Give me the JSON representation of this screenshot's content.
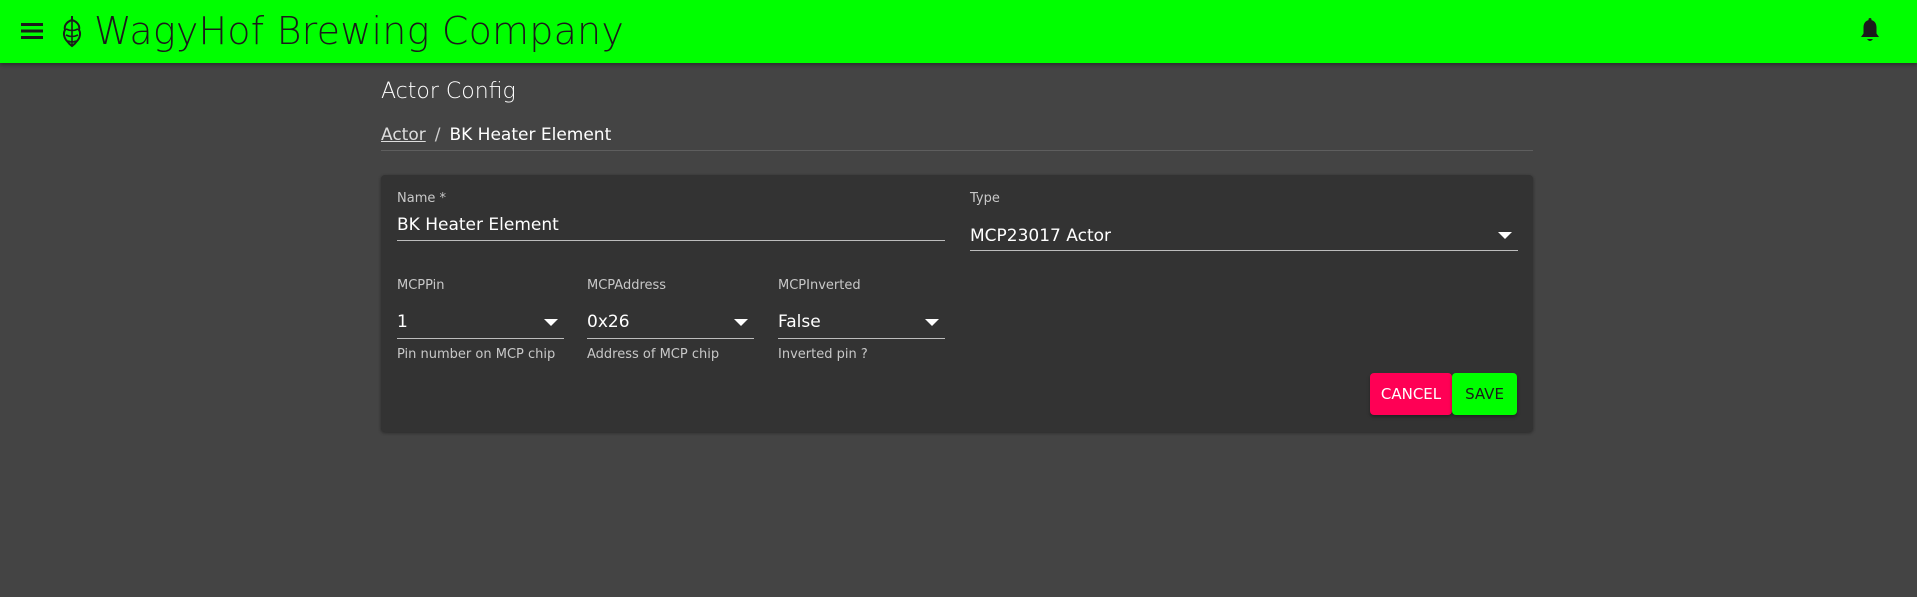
{
  "appbar": {
    "title": "WagyHof Brewing Company",
    "color": "#00ff00",
    "menu_icon": "menu-icon",
    "logo_icon": "hop-icon",
    "notification_icon": "bell-icon"
  },
  "page": {
    "title": "Actor Config"
  },
  "breadcrumb": {
    "parent": "Actor",
    "separator": "/",
    "current": "BK Heater Element"
  },
  "form": {
    "name": {
      "label": "Name *",
      "value": "BK Heater Element"
    },
    "type": {
      "label": "Type",
      "value": "MCP23017 Actor"
    },
    "mcp_pin": {
      "label": "MCPPin",
      "value": "1",
      "helper": "Pin number on MCP chip"
    },
    "mcp_address": {
      "label": "MCPAddress",
      "value": "0x26",
      "helper": "Address of MCP chip"
    },
    "mcp_inverted": {
      "label": "MCPInverted",
      "value": "False",
      "helper": "Inverted pin ?"
    }
  },
  "actions": {
    "cancel_label": "CANCEL",
    "cancel_color": "#ff0055",
    "save_label": "SAVE",
    "save_color": "#00ff00"
  }
}
